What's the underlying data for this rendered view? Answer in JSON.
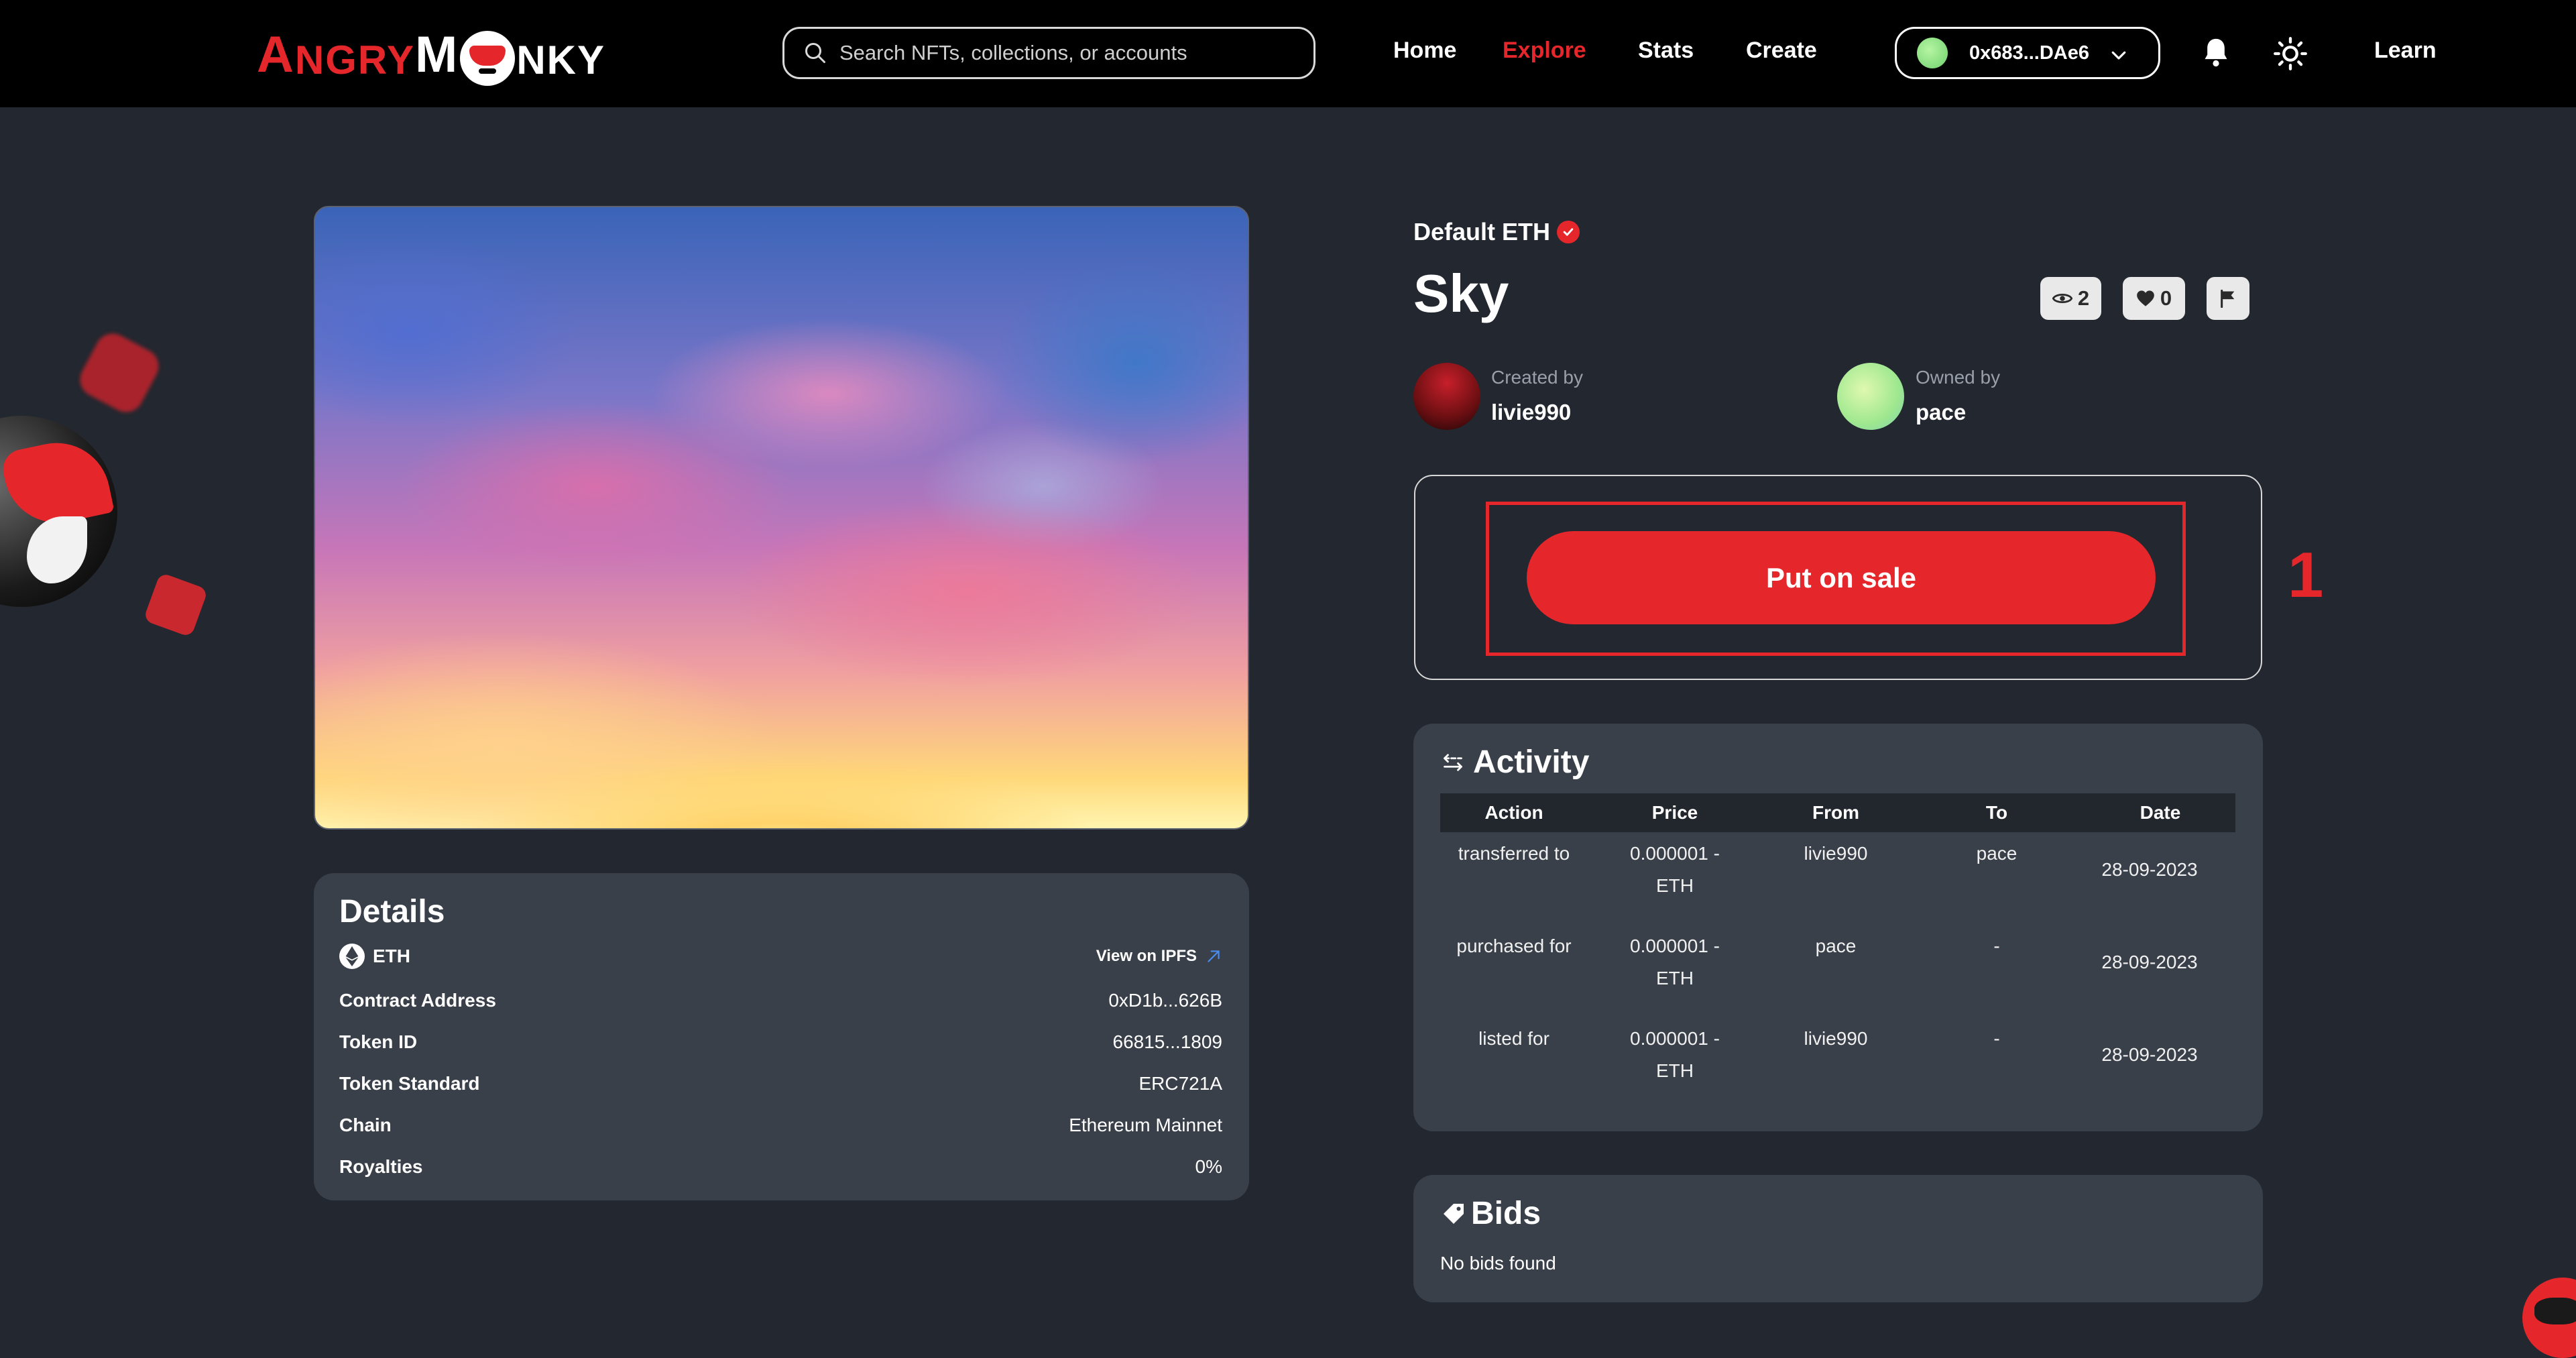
{
  "header": {
    "logo": {
      "part1": "A",
      "part2": "NGRY",
      "part3": "M",
      "part4": "NKY"
    },
    "search_placeholder": "Search NFTs, collections, or accounts",
    "nav": [
      {
        "label": "Home",
        "active": false
      },
      {
        "label": "Explore",
        "active": true
      },
      {
        "label": "Stats",
        "active": false
      },
      {
        "label": "Create",
        "active": false
      }
    ],
    "wallet_address": "0x683...DAe6",
    "learn_label": "Learn",
    "icons": [
      "search-icon",
      "chevron-down-icon",
      "bell-icon",
      "sun-icon"
    ]
  },
  "details": {
    "title": "Details",
    "currency": "ETH",
    "ipfs_label": "View on IPFS",
    "rows": [
      {
        "label": "Contract Address",
        "value": "0xD1b...626B"
      },
      {
        "label": "Token ID",
        "value": "66815...1809"
      },
      {
        "label": "Token Standard",
        "value": "ERC721A"
      },
      {
        "label": "Chain",
        "value": "Ethereum Mainnet"
      },
      {
        "label": "Royalties",
        "value": "0%"
      }
    ]
  },
  "nft": {
    "collection": "Default ETH",
    "title": "Sky",
    "views": "2",
    "likes": "0",
    "creator": {
      "sub": "Created by",
      "name": "livie990"
    },
    "owner": {
      "sub": "Owned by",
      "name": "pace"
    }
  },
  "sale": {
    "button_label": "Put on sale",
    "annotation": "1"
  },
  "activity": {
    "title": "Activity",
    "columns": [
      "Action",
      "Price",
      "From",
      "To",
      "Date"
    ],
    "rows": [
      {
        "action": "transferred to",
        "price1": "0.000001 -",
        "price2": "ETH",
        "from": "livie990",
        "to": "pace",
        "date": "28-09-2023"
      },
      {
        "action": "purchased for",
        "price1": "0.000001 -",
        "price2": "ETH",
        "from": "pace",
        "to": "-",
        "date": "28-09-2023"
      },
      {
        "action": "listed for",
        "price1": "0.000001 -",
        "price2": "ETH",
        "from": "livie990",
        "to": "-",
        "date": "28-09-2023"
      }
    ]
  },
  "bids": {
    "title": "Bids",
    "empty_text": "No bids found"
  },
  "colors": {
    "accent": "#e5272b",
    "background": "#23272f",
    "card": "#3a4049",
    "header": "#000000"
  }
}
